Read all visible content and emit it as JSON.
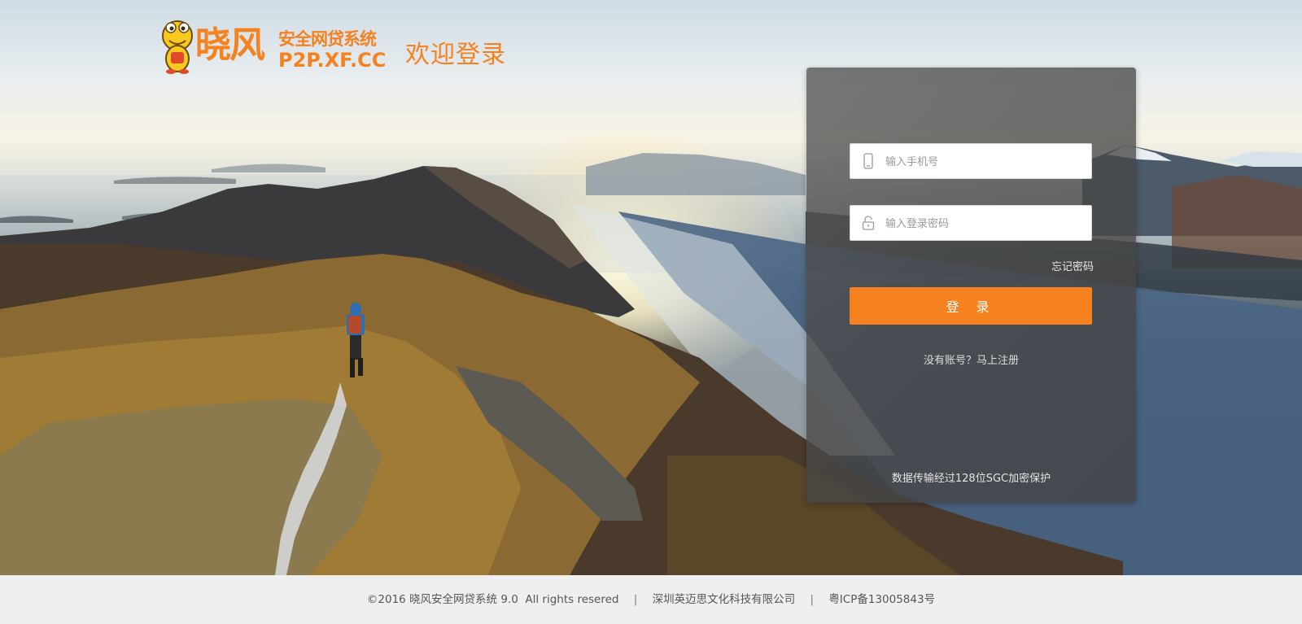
{
  "header": {
    "logo_cn": "晓风",
    "logo_sub": "安全网贷系统",
    "logo_domain": "P2P.XF.CC",
    "welcome": "欢迎登录"
  },
  "login": {
    "phone_placeholder": "输入手机号",
    "password_placeholder": "输入登录密码",
    "forgot_label": "忘记密码",
    "submit_label": "登 录",
    "register_label": "没有账号？马上注册",
    "security_note": "数据传输经过128位SGC加密保护"
  },
  "footer": {
    "copyright": "©2016 晓风安全网贷系统 9.0  All rights resered",
    "separator": "|",
    "company": "深圳英迈思文化科技有限公司",
    "icp": "粤ICP备13005843号"
  },
  "colors": {
    "accent": "#f5811f",
    "panel_bg": "rgba(72,72,72,0.78)",
    "footer_bg": "#efefef"
  },
  "icons": {
    "phone": "phone-icon",
    "lock": "lock-icon",
    "mascot": "mascot-icon"
  }
}
